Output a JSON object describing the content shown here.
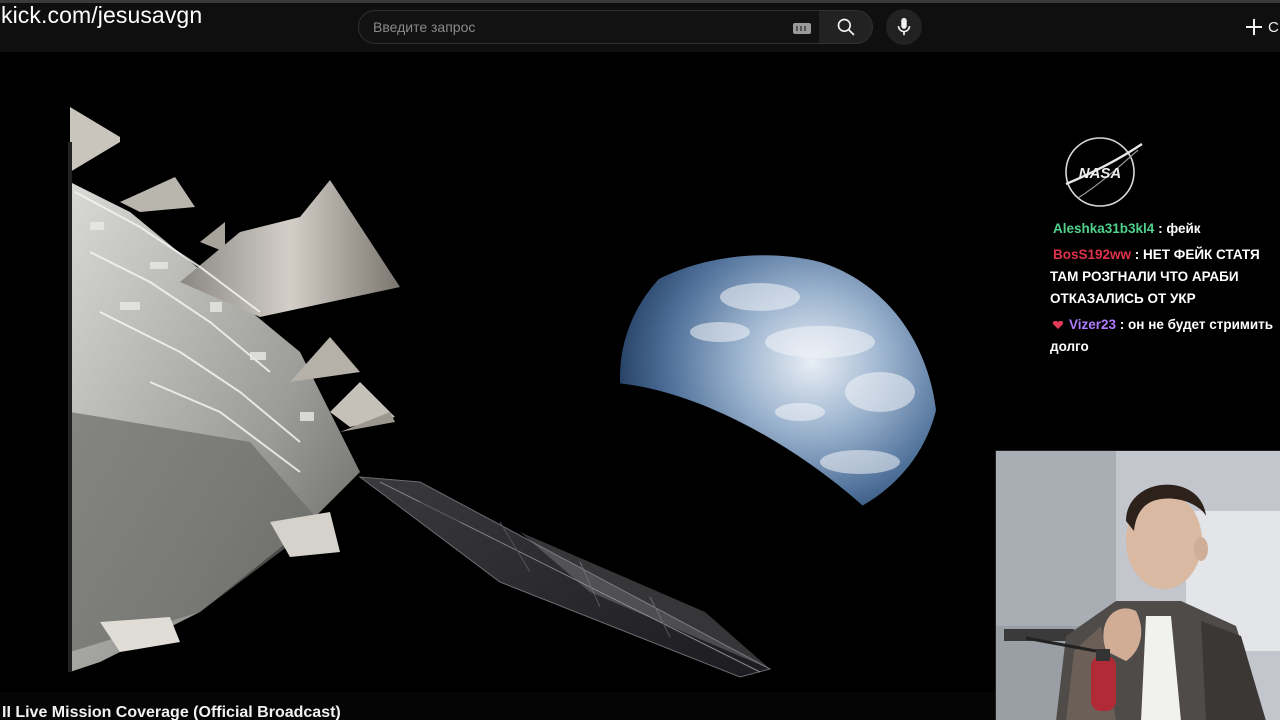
{
  "overlay": {
    "watermark": "kick.com/jesusavgn"
  },
  "search": {
    "placeholder": "Введите запрос"
  },
  "header": {
    "create_label": "С"
  },
  "video": {
    "logo_text": "NASA",
    "title": "II Live Mission Coverage (Official Broadcast)"
  },
  "chat": {
    "messages": [
      {
        "user": "Aleshka31b3kl4",
        "separator": " : ",
        "text": "фейк",
        "color": "#4fd18b"
      },
      {
        "user": "BosS192ww",
        "separator": " : ",
        "text": "НЕТ ФЕЙК СТАТЯ ТАМ РОЗГНАЛИ ЧТО АРАБИ ОТКАЗАЛИСЬ ОТ УКР",
        "color": "#e0334a"
      },
      {
        "user": "Vizer23",
        "separator": " : ",
        "text": "он не будет стримить долго",
        "color": "#b07cff",
        "badge": "heart-badge-icon"
      }
    ]
  },
  "colors": {
    "header_bg": "#0f0f0f",
    "search_bg": "#121212",
    "video_bg": "#000000"
  }
}
